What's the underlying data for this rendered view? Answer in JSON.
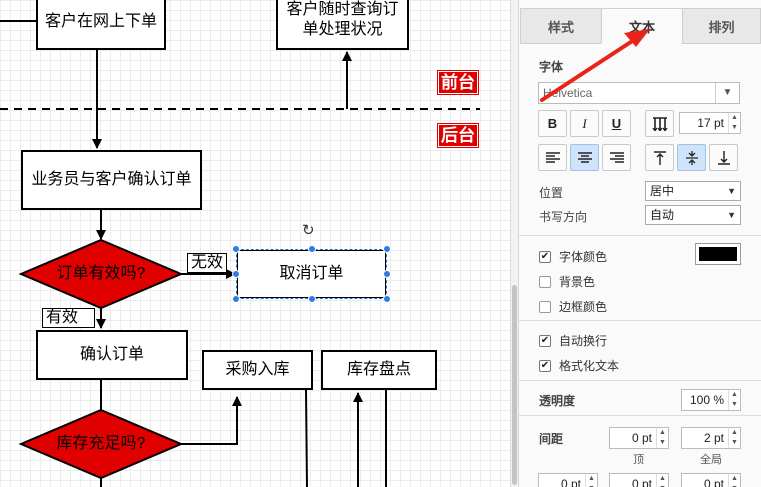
{
  "canvas": {
    "nodes": {
      "customer_order": "客户在网上下单",
      "customer_query": "客户随时查询订\n单处理状况",
      "confirm_with_customer": "业务员与客户确认订单",
      "order_valid": "订单有效吗?",
      "cancel_order": "取消订单",
      "confirm_order": "确认订单",
      "stock_enough": "库存充足吗?",
      "purchase_in": "采购入库",
      "stock_check": "库存盘点"
    },
    "edge_labels": {
      "invalid": "无效",
      "valid": "有效"
    },
    "tags": {
      "front": "前台",
      "back": "后台"
    },
    "colors": {
      "diamond": "#e00000",
      "selection": "#1e6fd9",
      "tag": "#e00000"
    }
  },
  "panel": {
    "tabs": [
      {
        "label": "样式",
        "active": false
      },
      {
        "label": "文本",
        "active": true
      },
      {
        "label": "排列",
        "active": false
      }
    ],
    "font": {
      "section_label": "字体",
      "font_name": "Helvetica",
      "size": "17 pt",
      "bold_label": "B",
      "italic_label": "I",
      "underline_label": "U"
    },
    "position_label": "位置",
    "position_value": "居中",
    "direction_label": "书写方向",
    "direction_value": "自动",
    "checks": [
      {
        "label": "字体颜色",
        "checked": true
      },
      {
        "label": "背景色",
        "checked": false
      },
      {
        "label": "边框颜色",
        "checked": false
      },
      {
        "label": "自动换行",
        "checked": true
      },
      {
        "label": "格式化文本",
        "checked": true
      }
    ],
    "font_color": "#000000",
    "opacity_label": "透明度",
    "opacity_value": "100 %",
    "spacing_label": "间距",
    "spacing_top_value": "0 pt",
    "spacing_global_value": "2 pt",
    "spacing_top_label": "顶",
    "spacing_global_label": "全局",
    "spacing_row2": [
      "0 pt",
      "0 pt",
      "0 pt"
    ]
  }
}
